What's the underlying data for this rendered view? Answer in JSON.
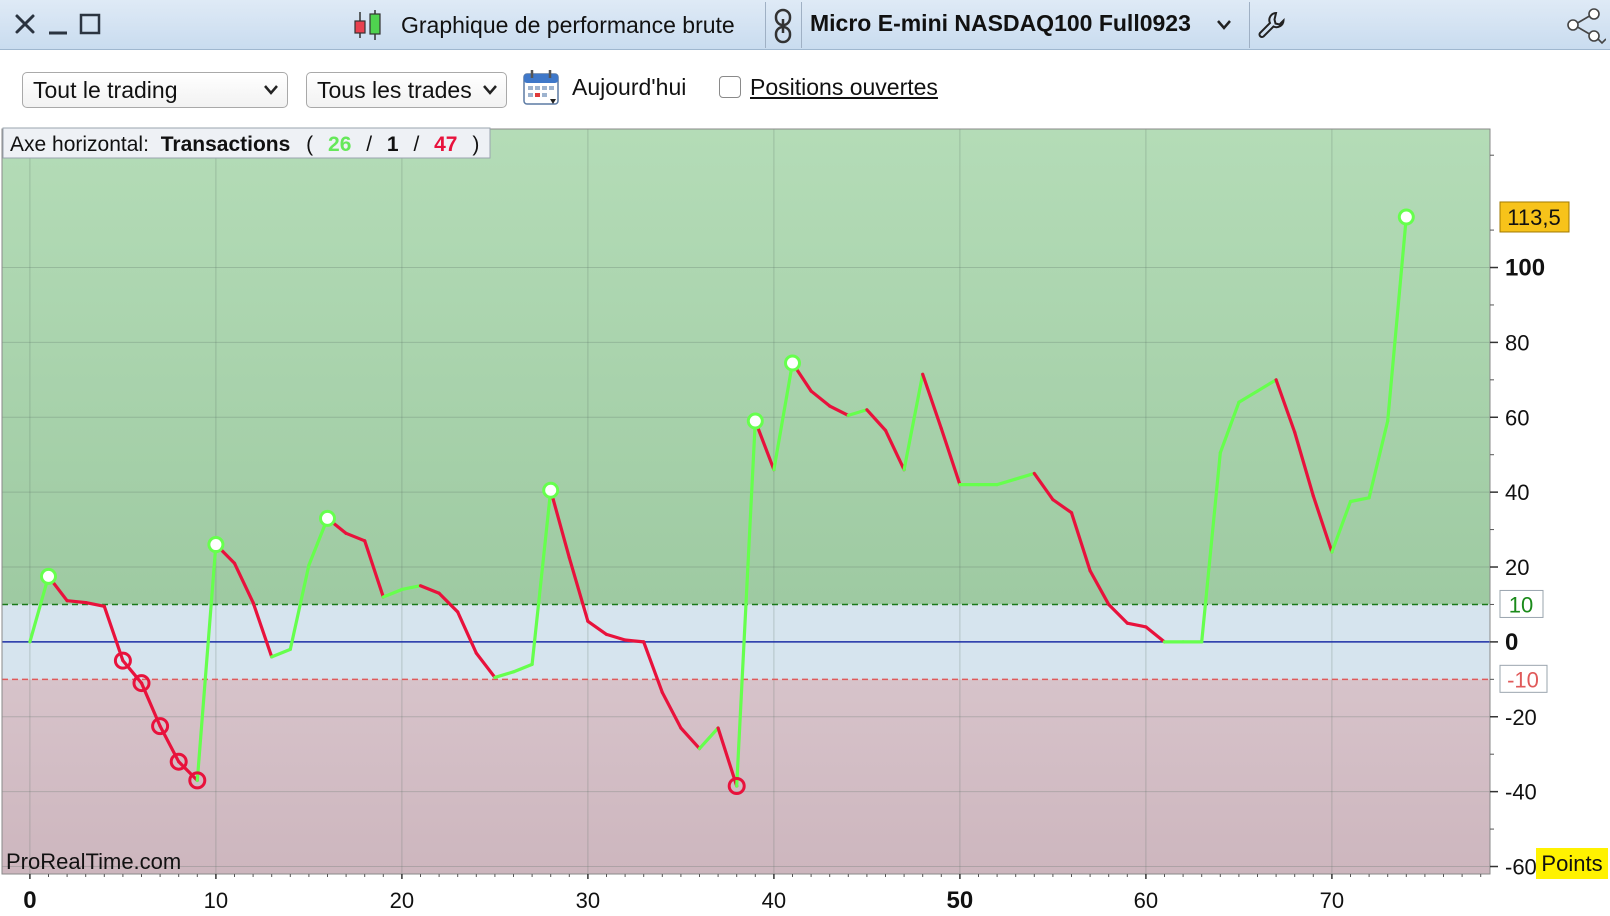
{
  "window": {
    "title": "Graphique de performance brute",
    "instrument": "Micro E-mini NASDAQ100 Full0923"
  },
  "toolbar": {
    "scope_select": "Tout le trading",
    "trades_select": "Tous les trades",
    "date_label": "Aujourd'hui",
    "open_positions_label": "Positions ouvertes",
    "open_positions_checked": false
  },
  "legend": {
    "prefix": "Axe horizontal:",
    "mode": "Transactions",
    "open_paren": "(",
    "wins": "26",
    "sep1": "/",
    "neutral": "1",
    "sep2": "/",
    "losses": "47",
    "close_paren": ")"
  },
  "watermark": "ProRealTime.com",
  "unit_label": "Points",
  "colors": {
    "gain_line": "#66ff4d",
    "loss_line": "#e8123c",
    "gain_zone": "#a9d6ad",
    "loss_zone": "#d2bcc4",
    "neutral_zone": "#d6e4ee",
    "last_value_bg": "#f7c31a",
    "unit_bg": "#fff200"
  },
  "chart_data": {
    "type": "line",
    "xlabel": "",
    "ylabel": "Points",
    "xlim": [
      -1.5,
      78.5
    ],
    "ylim": [
      -62,
      137
    ],
    "x_ticks": [
      "0",
      "10",
      "20",
      "30",
      "40",
      "50",
      "60",
      "70"
    ],
    "y_ticks": [
      "100",
      "80",
      "60",
      "40",
      "20",
      "0",
      "-20",
      "-40",
      "-60"
    ],
    "threshold_upper": "10",
    "threshold_lower": "-10",
    "last_value": "113,5",
    "equity": [
      0,
      17.5,
      11,
      10.5,
      9.5,
      -5,
      -11,
      -22.5,
      -32,
      -37,
      26,
      21,
      10.5,
      -4,
      -2,
      20.5,
      33,
      29,
      27,
      12,
      14,
      15,
      13,
      8,
      -3,
      -9.5,
      -8,
      -6,
      40.5,
      22.5,
      5.5,
      2,
      0.5,
      0,
      -13.5,
      -23,
      -28.5,
      -23,
      -38.5,
      59,
      46,
      74.5,
      67,
      63,
      60.5,
      62,
      56.5,
      46,
      71.5,
      57,
      42,
      42,
      42,
      43.5,
      45,
      38,
      34.5,
      19,
      10,
      5,
      4,
      0,
      0,
      0,
      50.5,
      64,
      67,
      70,
      56,
      39,
      24,
      37.5,
      38.5,
      59,
      113.5
    ],
    "highlight_gain_points": [
      1,
      10,
      16,
      28,
      39,
      41,
      74
    ],
    "highlight_loss_points": [
      5,
      6,
      7,
      8,
      9,
      38
    ]
  }
}
